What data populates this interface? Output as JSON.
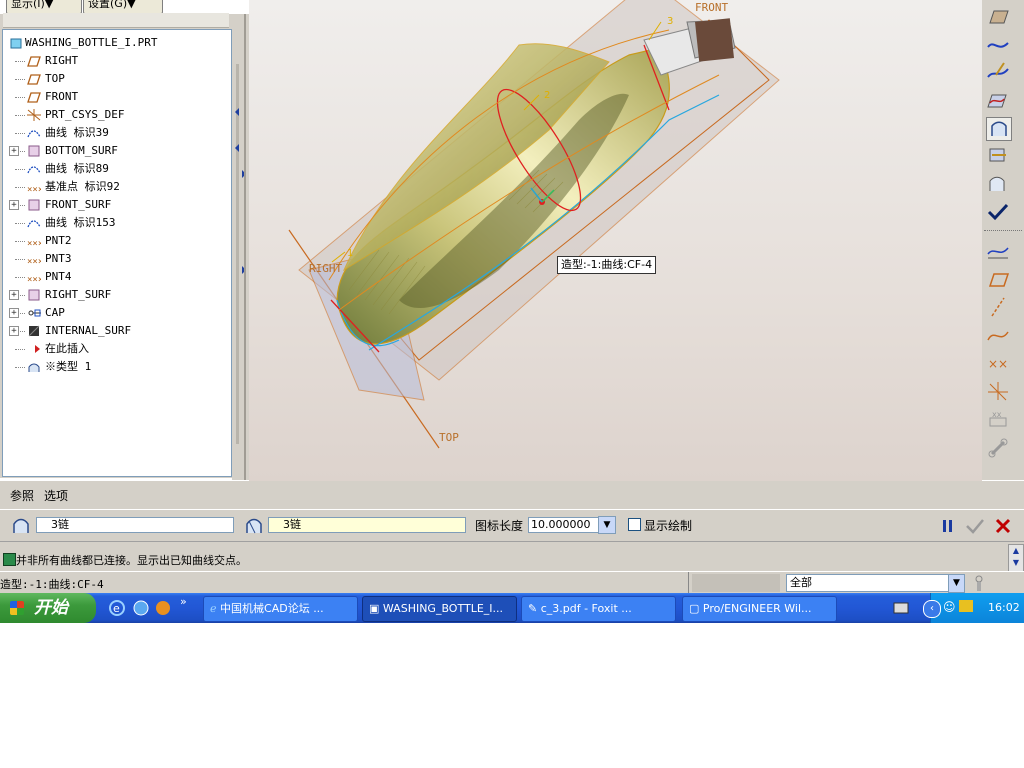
{
  "menu": {
    "display_label": "显示(I)▼",
    "settings_label": "设置(G)▼"
  },
  "tree": {
    "items": [
      {
        "label": "WASHING_BOTTLE_I.PRT",
        "icon": "part-icon",
        "expand": false
      },
      {
        "label": "RIGHT",
        "icon": "datum-plane-icon",
        "expand": false
      },
      {
        "label": "TOP",
        "icon": "datum-plane-icon",
        "expand": false
      },
      {
        "label": "FRONT",
        "icon": "datum-plane-icon",
        "expand": false
      },
      {
        "label": "PRT_CSYS_DEF",
        "icon": "csys-icon",
        "expand": false
      },
      {
        "label": "曲线 标识39",
        "icon": "curve-icon",
        "expand": false
      },
      {
        "label": "BOTTOM_SURF",
        "icon": "surface-icon",
        "expand": true
      },
      {
        "label": "曲线 标识89",
        "icon": "curve-icon",
        "expand": false
      },
      {
        "label": "基准点 标识92",
        "icon": "datum-point-icon",
        "expand": false
      },
      {
        "label": "FRONT_SURF",
        "icon": "surface-icon",
        "expand": true
      },
      {
        "label": "曲线 标识153",
        "icon": "curve-icon",
        "expand": false
      },
      {
        "label": "PNT2",
        "icon": "datum-point-icon",
        "expand": false
      },
      {
        "label": "PNT3",
        "icon": "datum-point-icon",
        "expand": false
      },
      {
        "label": "PNT4",
        "icon": "datum-point-icon",
        "expand": false
      },
      {
        "label": "RIGHT_SURF",
        "icon": "surface-icon",
        "expand": true
      },
      {
        "label": "CAP",
        "icon": "group-icon",
        "expand": true
      },
      {
        "label": "INTERNAL_SURF",
        "icon": "solid-surface-icon",
        "expand": true
      },
      {
        "label": "在此插入",
        "icon": "insert-arrow-icon",
        "expand": false
      },
      {
        "label": "※类型 1",
        "icon": "boundary-blend-icon",
        "expand": false
      }
    ]
  },
  "viewport": {
    "tooltip": "造型:-1:曲线:CF-4",
    "plane_labels": {
      "front": "FRONT",
      "right": "RIGHT",
      "top": "TOP"
    },
    "curve_tags": {
      "t1": "1",
      "t2": "2",
      "t3": "3"
    }
  },
  "dashboard": {
    "tab_references": "参照",
    "tab_options": "选项",
    "chain1_value": "3链",
    "chain2_value": "3链",
    "icon_length_label": "图标长度",
    "icon_length_value": "10.000000",
    "show_draft_label": "显示绘制"
  },
  "message": "并非所有曲线都已连接。显示出已知曲线交点。",
  "status": {
    "left_text": "造型:-1:曲线:CF-4",
    "filter_value": "全部"
  },
  "taskbar": {
    "start_label": "开始",
    "tasks": [
      "中国机械CAD论坛 ...",
      "WASHING_BOTTLE_I...",
      "c_3.pdf - Foxit ...",
      "Pro/ENGINEER Wil..."
    ],
    "clock": "16:02"
  },
  "colors": {
    "accent_blue": "#245edb",
    "start_green": "#3c9a3c",
    "datum_orange": "#c86a20",
    "surface_yellow": "#d8cf7a",
    "cancel_red": "#c00000",
    "ok_check": "#0a246a"
  }
}
